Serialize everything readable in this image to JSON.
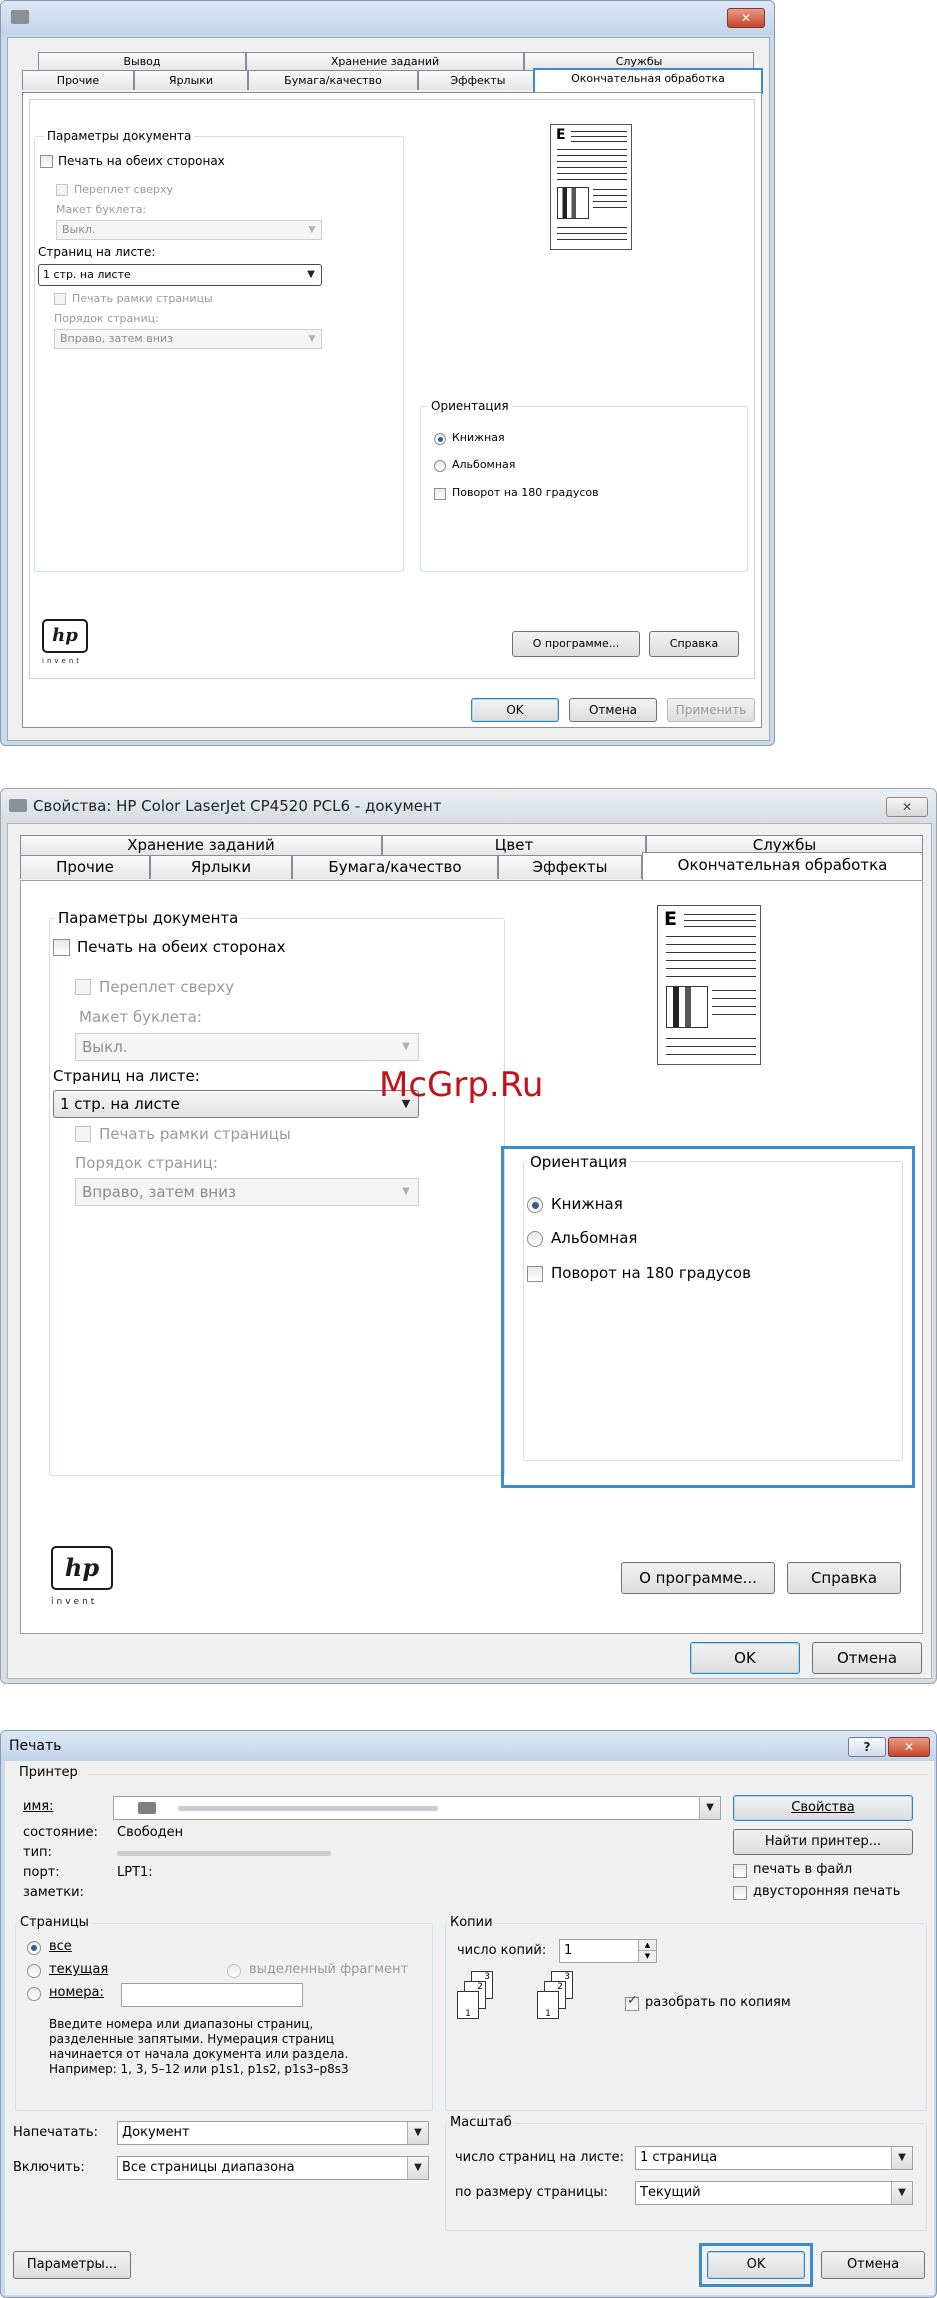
{
  "colors": {
    "highlight": "#3c8ad0",
    "window_frame": "#c9d9ec",
    "close_red": "#c7442b"
  },
  "dialog1": {
    "close_icon": "close-icon",
    "tabs_row1": [
      "Вывод",
      "Хранение заданий",
      "Службы"
    ],
    "tabs_row2": [
      "Прочие",
      "Ярлыки",
      "Бумага/качество",
      "Эффекты",
      "Окончательная обработка"
    ],
    "doc_params": {
      "title": "Параметры документа",
      "duplex": "Печать на обеих сторонах",
      "bind_top": "Переплет сверху",
      "booklet_label": "Макет буклета:",
      "booklet_value": "Выкл.",
      "pages_per_sheet_label": "Страниц на листе:",
      "pages_per_sheet_value": "1 стр. на листе",
      "print_borders": "Печать рамки страницы",
      "page_order_label": "Порядок страниц:",
      "page_order_value": "Вправо, затем вниз"
    },
    "orientation": {
      "title": "Ориентация",
      "portrait": "Книжная",
      "landscape": "Альбомная",
      "rotate": "Поворот на 180 градусов"
    },
    "logo_text": "hp",
    "invent": "invent",
    "about_button": "О программе...",
    "help_button": "Справка",
    "ok": "OK",
    "cancel": "Отмена",
    "apply": "Применить"
  },
  "dialog2": {
    "title": "Свойства: HP Color LaserJet CP4520 PCL6 - документ",
    "close_icon": "close-icon",
    "tabs_row1": [
      "Хранение заданий",
      "Цвет",
      "Службы"
    ],
    "tabs_row2": [
      "Прочие",
      "Ярлыки",
      "Бумага/качество",
      "Эффекты",
      "Окончательная обработка"
    ],
    "doc_params": {
      "title": "Параметры документа",
      "duplex": "Печать на обеих сторонах",
      "bind_top": "Переплет сверху",
      "booklet_label": "Макет буклета:",
      "booklet_value": "Выкл.",
      "pages_per_sheet_label": "Страниц на листе:",
      "pages_per_sheet_value": "1 стр. на листе",
      "print_borders": "Печать рамки страницы",
      "page_order_label": "Порядок страниц:",
      "page_order_value": "Вправо, затем вниз"
    },
    "orientation": {
      "title": "Ориентация",
      "portrait": "Книжная",
      "landscape": "Альбомная",
      "rotate": "Поворот на 180 градусов"
    },
    "logo_text": "hp",
    "invent": "invent",
    "about_button": "О программе...",
    "help_button": "Справка",
    "ok": "OK",
    "cancel": "Отмена",
    "watermark": "McGrp.Ru"
  },
  "dialog3": {
    "title": "Печать",
    "help_icon": "help-icon",
    "close_icon": "close-icon",
    "printer": {
      "group": "Принтер",
      "name_label": "имя:",
      "status_label": "состояние:",
      "status_value": "Свободен",
      "type_label": "тип:",
      "port_label": "порт:",
      "port_value": "LPT1:",
      "notes_label": "заметки:",
      "properties_button": "Свойства",
      "find_button": "Найти принтер...",
      "print_to_file": "печать в файл",
      "duplex": "двусторонняя печать"
    },
    "pages": {
      "group": "Страницы",
      "all": "все",
      "current": "текущая",
      "selection": "выделенный фрагмент",
      "numbers": "номера:",
      "hint1": "Введите номера или диапазоны страниц,",
      "hint2": "разделенные запятыми. Нумерация страниц",
      "hint3": "начинается от начала документа или раздела.",
      "hint4": "Например: 1, 3, 5–12 или p1s1, p1s2, p1s3–p8s3"
    },
    "copies": {
      "group": "Копии",
      "count_label": "число копий:",
      "count_value": "1",
      "collate": "разобрать по копиям"
    },
    "print_what_label": "Напечатать:",
    "print_what_value": "Документ",
    "include_label": "Включить:",
    "include_value": "Все страницы диапазона",
    "zoom": {
      "group": "Масштаб",
      "pps_label": "число страниц на листе:",
      "pps_value": "1 страница",
      "scale_label": "по размеру страницы:",
      "scale_value": "Текущий"
    },
    "options_button": "Параметры...",
    "ok": "OK",
    "cancel": "Отмена"
  }
}
